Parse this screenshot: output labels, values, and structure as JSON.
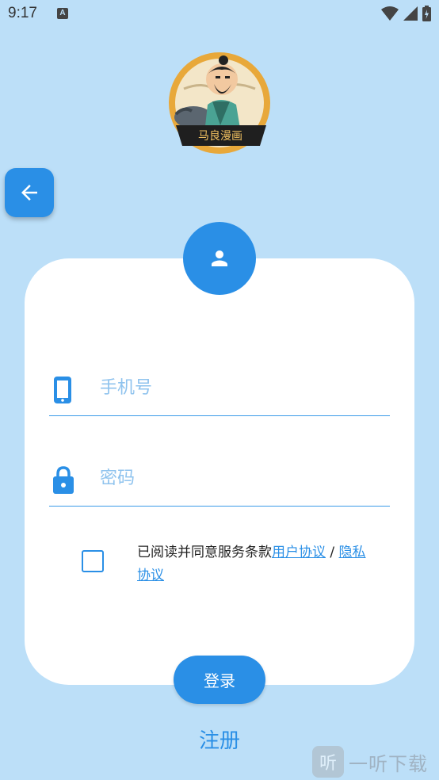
{
  "status_bar": {
    "time": "9:17",
    "notification_icon_letter": "A"
  },
  "logo": {
    "text": "马良漫画"
  },
  "form": {
    "phone_placeholder": "手机号",
    "password_placeholder": "密码",
    "agree_prefix": "已阅读并同意服务条款",
    "user_agreement": "用户协议",
    "separator": " / ",
    "privacy_agreement": "隐私协议"
  },
  "actions": {
    "login_label": "登录",
    "register_label": "注册"
  },
  "watermark": {
    "logo_char": "听",
    "text": "一听下载"
  },
  "colors": {
    "background": "#bcdff8",
    "accent": "#2a8fe6",
    "card": "#ffffff",
    "placeholder": "#8fc3ee"
  }
}
